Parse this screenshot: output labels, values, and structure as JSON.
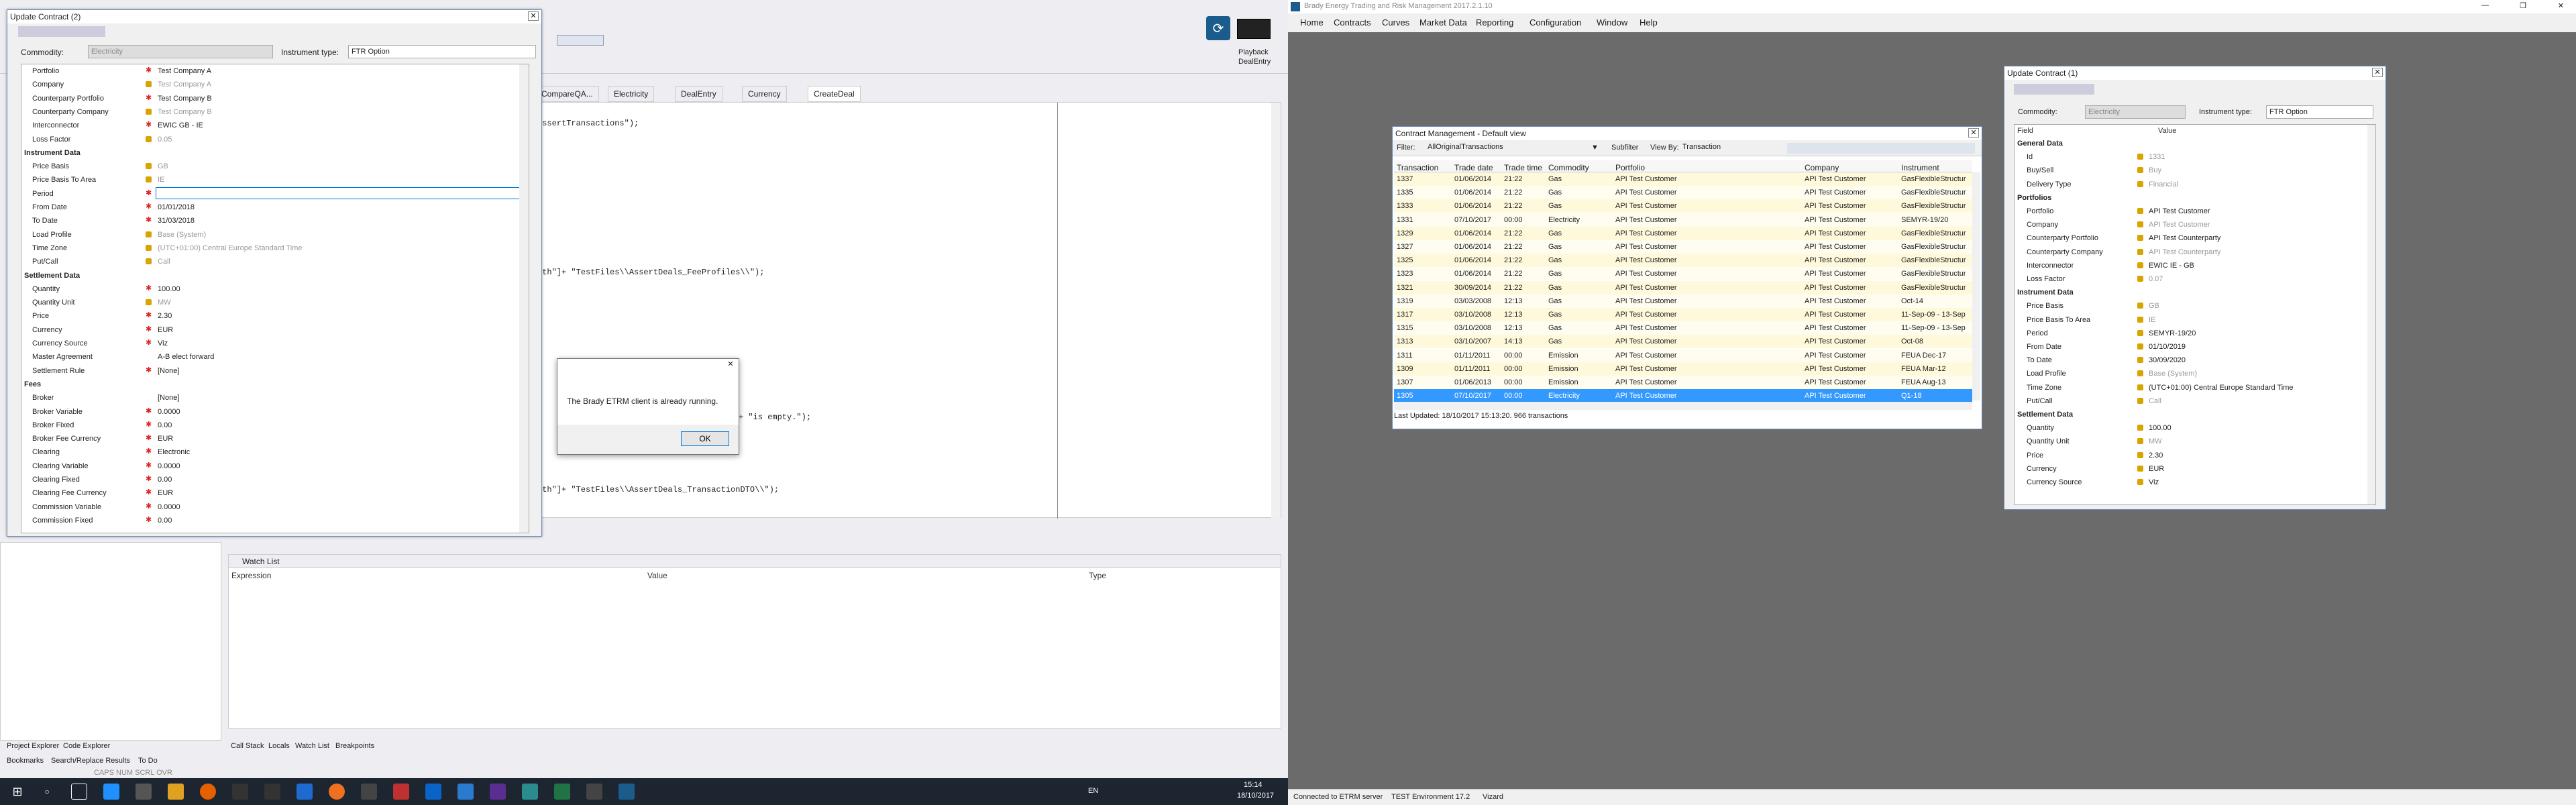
{
  "ide": {
    "tabs": [
      "CompareQA...",
      "Electricity",
      "DealEntry",
      "Currency",
      "CreateDeal"
    ],
    "code_lines": [
      "AssertTransactions\");",
      "ath\"]+ \"TestFiles\\\\AssertDeals_FeeProfiles\\\\\");",
      "+ \"is empty.\");",
      "ath\"]+ \"TestFiles\\\\AssertDeals_TransactionDTO\\\\\");"
    ],
    "playback_label": "Playback",
    "dealentry_label": "DealEntry",
    "solution_tabs": [
      "Project Explorer",
      "Code Explorer"
    ],
    "watch_title": "Watch List",
    "watch_columns": [
      "Expression",
      "Value",
      "Type"
    ],
    "debug_tabs": [
      "Call Stack",
      "Locals",
      "Watch List",
      "Breakpoints"
    ],
    "status_tabs": [
      "Bookmarks",
      "Search/Replace Results",
      "To Do"
    ],
    "status_indicators": "CAPS NUM SCRL OVR"
  },
  "taskbar": {
    "lang": "EN",
    "time": "15:14",
    "date": "18/10/2017"
  },
  "uc2": {
    "title": "Update Contract (2)",
    "commodity_label": "Commodity:",
    "commodity_value": "Electricity",
    "instrument_label": "Instrument type:",
    "instrument_value": "FTR Option",
    "rows": [
      {
        "label": "Portfolio",
        "value": "Test Company A",
        "kind": "req"
      },
      {
        "label": "Company",
        "value": "Test Company A",
        "kind": "lock"
      },
      {
        "label": "Counterparty Portfolio",
        "value": "Test Company B",
        "kind": "req"
      },
      {
        "label": "Counterparty Company",
        "value": "Test Company B",
        "kind": "lock"
      },
      {
        "label": "Interconnector",
        "value": "EWIC GB - IE",
        "kind": "req"
      },
      {
        "label": "Loss Factor",
        "value": "0.05",
        "kind": "lock"
      },
      {
        "label": "Instrument Data",
        "value": "",
        "kind": "sec"
      },
      {
        "label": "Price Basis",
        "value": "GB",
        "kind": "lock"
      },
      {
        "label": "Price Basis To Area",
        "value": "IE",
        "kind": "lock"
      },
      {
        "label": "Period",
        "value": "",
        "kind": "req"
      },
      {
        "label": "From Date",
        "value": "01/01/2018",
        "kind": "req"
      },
      {
        "label": "To Date",
        "value": "31/03/2018",
        "kind": "req"
      },
      {
        "label": "Load Profile",
        "value": "Base (System)",
        "kind": "lock"
      },
      {
        "label": "Time Zone",
        "value": "(UTC+01:00) Central Europe Standard Time",
        "kind": "lock"
      },
      {
        "label": "Put/Call",
        "value": "Call",
        "kind": "lock"
      },
      {
        "label": "Settlement Data",
        "value": "",
        "kind": "sec"
      },
      {
        "label": "Quantity",
        "value": "100.00",
        "kind": "req"
      },
      {
        "label": "Quantity Unit",
        "value": "MW",
        "kind": "lock"
      },
      {
        "label": "Price",
        "value": "2.30",
        "kind": "req"
      },
      {
        "label": "Currency",
        "value": "EUR",
        "kind": "req"
      },
      {
        "label": "Currency Source",
        "value": "Viz",
        "kind": "req"
      },
      {
        "label": "Master Agreement",
        "value": "A-B elect forward",
        "kind": "none"
      },
      {
        "label": "Settlement Rule",
        "value": "[None]",
        "kind": "req"
      },
      {
        "label": "Fees",
        "value": "",
        "kind": "sec"
      },
      {
        "label": "Broker",
        "value": "[None]",
        "kind": "none"
      },
      {
        "label": "Broker Variable",
        "value": "0.0000",
        "kind": "req"
      },
      {
        "label": "Broker Fixed",
        "value": "0.00",
        "kind": "req"
      },
      {
        "label": "Broker Fee Currency",
        "value": "EUR",
        "kind": "req"
      },
      {
        "label": "Clearing",
        "value": "Electronic",
        "kind": "req"
      },
      {
        "label": "Clearing Variable",
        "value": "0.0000",
        "kind": "req"
      },
      {
        "label": "Clearing Fixed",
        "value": "0.00",
        "kind": "req"
      },
      {
        "label": "Clearing Fee Currency",
        "value": "EUR",
        "kind": "req"
      },
      {
        "label": "Commission Variable",
        "value": "0.0000",
        "kind": "req"
      },
      {
        "label": "Commission Fixed",
        "value": "0.00",
        "kind": "req"
      }
    ]
  },
  "dialog": {
    "message": "The Brady ETRM client is already running.",
    "ok": "OK"
  },
  "brady": {
    "title": "Brady Energy Trading and Risk Management 2017.2.1.10",
    "menu": [
      "Home",
      "Contracts",
      "Curves",
      "Market Data",
      "Reporting",
      "Configuration",
      "Window",
      "Help"
    ],
    "status_server": "Connected to ETRM server",
    "status_env": "TEST Environment 17.2",
    "status_user": "Vizard"
  },
  "cm": {
    "title": "Contract Management - Default view",
    "filter_label": "Filter:",
    "filter_value": "AllOriginalTransactions",
    "subfilter_label": "Subfilter",
    "viewby_label": "View By:",
    "viewby_value": "Transaction",
    "columns": [
      "Transaction",
      "Trade date",
      "Trade time",
      "Commodity",
      "Portfolio",
      "Company",
      "Instrument"
    ],
    "rows": [
      [
        "1337",
        "01/06/2014",
        "21:22",
        "Gas",
        "API Test Customer",
        "API Test Customer",
        "GasFlexibleStructur"
      ],
      [
        "1335",
        "01/06/2014",
        "21:22",
        "Gas",
        "API Test Customer",
        "API Test Customer",
        "GasFlexibleStructur"
      ],
      [
        "1333",
        "01/06/2014",
        "21:22",
        "Gas",
        "API Test Customer",
        "API Test Customer",
        "GasFlexibleStructur"
      ],
      [
        "1331",
        "07/10/2017",
        "00:00",
        "Electricity",
        "API Test Customer",
        "API Test Customer",
        "SEMYR-19/20"
      ],
      [
        "1329",
        "01/06/2014",
        "21:22",
        "Gas",
        "API Test Customer",
        "API Test Customer",
        "GasFlexibleStructur"
      ],
      [
        "1327",
        "01/06/2014",
        "21:22",
        "Gas",
        "API Test Customer",
        "API Test Customer",
        "GasFlexibleStructur"
      ],
      [
        "1325",
        "01/06/2014",
        "21:22",
        "Gas",
        "API Test Customer",
        "API Test Customer",
        "GasFlexibleStructur"
      ],
      [
        "1323",
        "01/06/2014",
        "21:22",
        "Gas",
        "API Test Customer",
        "API Test Customer",
        "GasFlexibleStructur"
      ],
      [
        "1321",
        "30/09/2014",
        "21:22",
        "Gas",
        "API Test Customer",
        "API Test Customer",
        "GasFlexibleStructur"
      ],
      [
        "1319",
        "03/03/2008",
        "12:13",
        "Gas",
        "API Test Customer",
        "API Test Customer",
        "Oct-14"
      ],
      [
        "1317",
        "03/10/2008",
        "12:13",
        "Gas",
        "API Test Customer",
        "API Test Customer",
        "11-Sep-09 - 13-Sep"
      ],
      [
        "1315",
        "03/10/2008",
        "12:13",
        "Gas",
        "API Test Customer",
        "API Test Customer",
        "11-Sep-09 - 13-Sep"
      ],
      [
        "1313",
        "03/10/2007",
        "14:13",
        "Gas",
        "API Test Customer",
        "API Test Customer",
        "Oct-08"
      ],
      [
        "1311",
        "01/11/2011",
        "00:00",
        "Emission",
        "API Test Customer",
        "API Test Customer",
        "FEUA Dec-17"
      ],
      [
        "1309",
        "01/11/2011",
        "00:00",
        "Emission",
        "API Test Customer",
        "API Test Customer",
        "FEUA Mar-12"
      ],
      [
        "1307",
        "01/06/2013",
        "00:00",
        "Emission",
        "API Test Customer",
        "API Test Customer",
        "FEUA Aug-13"
      ],
      [
        "1305",
        "07/10/2017",
        "00:00",
        "Electricity",
        "API Test Customer",
        "API Test Customer",
        "Q1-18"
      ]
    ],
    "footer": "Last Updated: 18/10/2017 15:13:20. 966 transactions"
  },
  "uc1": {
    "title": "Update Contract (1)",
    "commodity_label": "Commodity:",
    "commodity_value": "Electricity",
    "instrument_label": "Instrument type:",
    "instrument_value": "FTR Option",
    "col_field": "Field",
    "col_value": "Value",
    "rows": [
      {
        "label": "General Data",
        "value": "",
        "kind": "sec"
      },
      {
        "label": "Id",
        "value": "1331",
        "kind": "lockdim"
      },
      {
        "label": "Buy/Sell",
        "value": "Buy",
        "kind": "lockdim"
      },
      {
        "label": "Delivery Type",
        "value": "Financial",
        "kind": "lockdim"
      },
      {
        "label": "Portfolios",
        "value": "",
        "kind": "sec"
      },
      {
        "label": "Portfolio",
        "value": "API Test Customer",
        "kind": "lock"
      },
      {
        "label": "Company",
        "value": "API Test Customer",
        "kind": "lockdim"
      },
      {
        "label": "Counterparty Portfolio",
        "value": "API Test Counterparty",
        "kind": "lock"
      },
      {
        "label": "Counterparty Company",
        "value": "API Test Counterparty",
        "kind": "lockdim"
      },
      {
        "label": "Interconnector",
        "value": "EWIC IE - GB",
        "kind": "lock"
      },
      {
        "label": "Loss Factor",
        "value": "0.07",
        "kind": "lockdim"
      },
      {
        "label": "Instrument Data",
        "value": "",
        "kind": "sec"
      },
      {
        "label": "Price Basis",
        "value": "GB",
        "kind": "lockdim"
      },
      {
        "label": "Price Basis To Area",
        "value": "IE",
        "kind": "lockdim"
      },
      {
        "label": "Period",
        "value": "SEMYR-19/20",
        "kind": "lock"
      },
      {
        "label": "From Date",
        "value": "01/10/2019",
        "kind": "lock"
      },
      {
        "label": "To Date",
        "value": "30/09/2020",
        "kind": "lock"
      },
      {
        "label": "Load Profile",
        "value": "Base (System)",
        "kind": "lockdim"
      },
      {
        "label": "Time Zone",
        "value": "(UTC+01:00) Central Europe Standard Time",
        "kind": "lock"
      },
      {
        "label": "Put/Call",
        "value": "Call",
        "kind": "lockdim"
      },
      {
        "label": "Settlement Data",
        "value": "",
        "kind": "sec"
      },
      {
        "label": "Quantity",
        "value": "100.00",
        "kind": "lock"
      },
      {
        "label": "Quantity Unit",
        "value": "MW",
        "kind": "lockdim"
      },
      {
        "label": "Price",
        "value": "2.30",
        "kind": "lock"
      },
      {
        "label": "Currency",
        "value": "EUR",
        "kind": "lock"
      },
      {
        "label": "Currency Source",
        "value": "Viz",
        "kind": "lock"
      }
    ]
  },
  "colors": {
    "selection": "#3399ff",
    "row_highlight": "#fff9dc",
    "required": "#dd2222",
    "lock": "#d8a400"
  }
}
